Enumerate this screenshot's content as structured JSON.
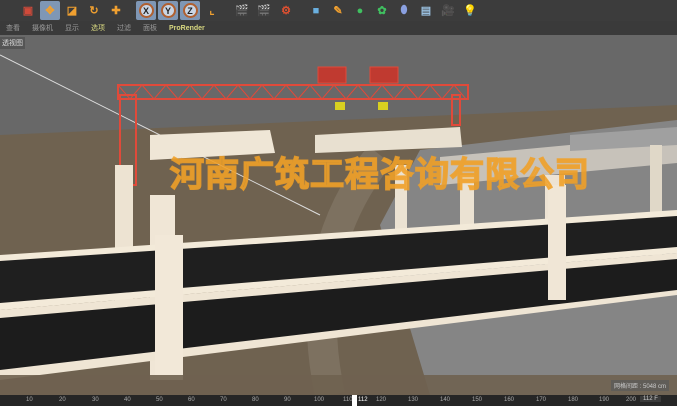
{
  "toolbar": {
    "icons": [
      "move-mode-icon",
      "move-icon",
      "scale-icon",
      "rotate-icon",
      "last-tool-icon",
      "x-axis-lock",
      "y-axis-lock",
      "z-axis-lock",
      "coordinate-system-icon",
      "render-view-icon",
      "render-picture-icon",
      "render-settings-icon",
      "cube-icon",
      "pen-icon",
      "subdivision-icon",
      "array-icon",
      "deformer-icon",
      "floor-icon",
      "camera-icon",
      "light-icon"
    ],
    "axis_labels": [
      "X",
      "Y",
      "Z"
    ]
  },
  "menu": {
    "items": [
      "查看",
      "摄像机",
      "显示",
      "选项",
      "过滤",
      "面板",
      "ProRender"
    ]
  },
  "viewport": {
    "label": "透视图",
    "grid_info": "网格间距 : 5048 cm",
    "watermark": "河南广筑工程咨询有限公司"
  },
  "timeline": {
    "ticks": [
      "10",
      "20",
      "30",
      "40",
      "50",
      "60",
      "70",
      "80",
      "90",
      "100",
      "110",
      "112",
      "120",
      "130",
      "140",
      "150",
      "160",
      "170",
      "180",
      "190",
      "200"
    ],
    "current_frame": "112 F"
  },
  "colors": {
    "accent": "#f0a030",
    "crane": "#e04a3a",
    "selection": "#7f97b5"
  }
}
